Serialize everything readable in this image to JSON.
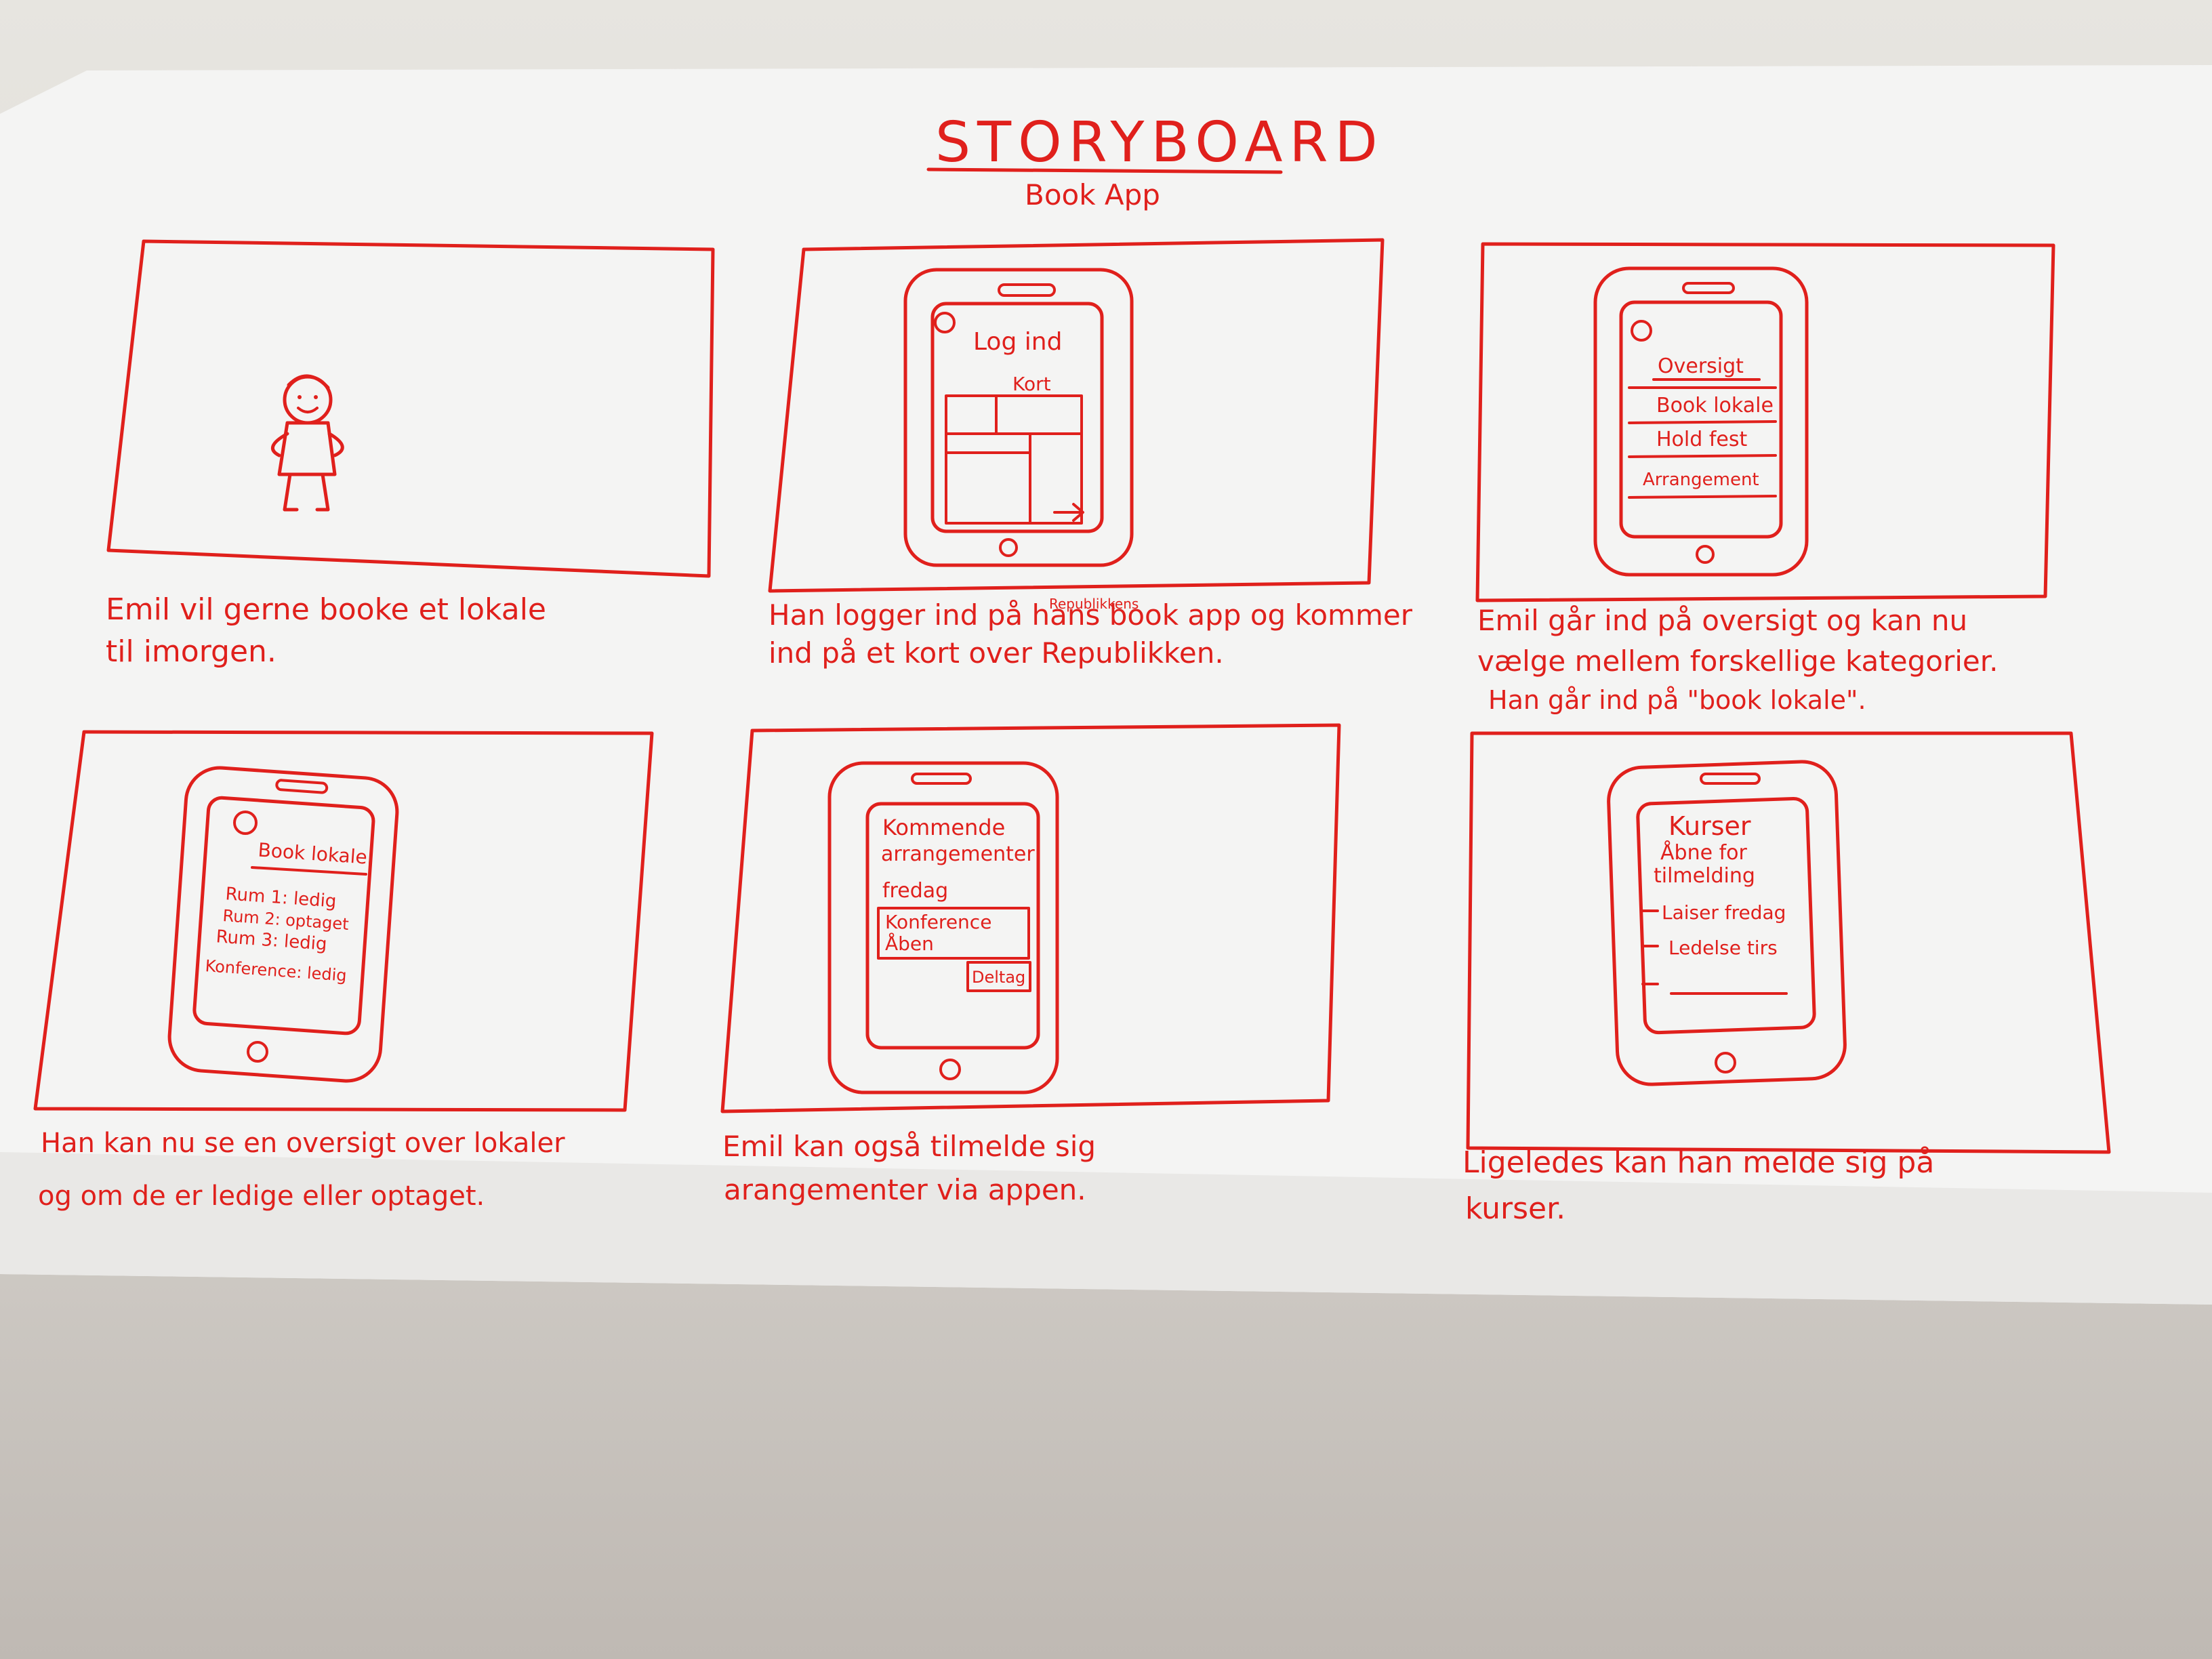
{
  "header": {
    "title": "STORYBOARD",
    "subtitle": "Book App"
  },
  "panels": [
    {
      "caption_lines": [
        "Emil vil gerne booke et lokale",
        "til imorgen."
      ]
    },
    {
      "screen": {
        "title": "Log ind",
        "label": "Kort"
      },
      "caption_insert": "Republikkens",
      "caption_strike": "hans",
      "caption_lines": [
        "Han logger ind på hans book app og kommer",
        "ind på et kort over Republikken."
      ]
    },
    {
      "screen": {
        "items": [
          "Oversigt",
          "Book lokale",
          "Hold fest",
          "Arrangement"
        ]
      },
      "caption_lines": [
        "Emil går ind på oversigt og kan nu",
        "vælge mellem forskellige kategorier.",
        "Han går ind på \"book lokale\"."
      ]
    },
    {
      "screen": {
        "title": "Book lokale.",
        "rows": [
          "Rum 1: ledig",
          "Rum 2: optaget",
          "Rum 3: ledig",
          "Konference: ledig"
        ]
      },
      "caption_lines": [
        "Han kan nu se en oversigt over lokaler",
        "og om de er ledige eller optaget."
      ]
    },
    {
      "screen": {
        "title_lines": [
          "Kommende",
          "arrangementer"
        ],
        "day": "fredag",
        "event_lines": [
          "Konference",
          "Åben"
        ],
        "action": "Deltag"
      },
      "caption_lines": [
        "Emil kan også tilmelde sig",
        "arangementer via appen."
      ]
    },
    {
      "screen": {
        "title": "Kurser",
        "subtitle_lines": [
          "Åbne for",
          "tilmelding"
        ],
        "rows": [
          "Laiser fredag",
          "Ledelse tirs"
        ]
      },
      "caption_lines": [
        "Ligeledes kan han melde sig på",
        "kurser."
      ]
    }
  ]
}
